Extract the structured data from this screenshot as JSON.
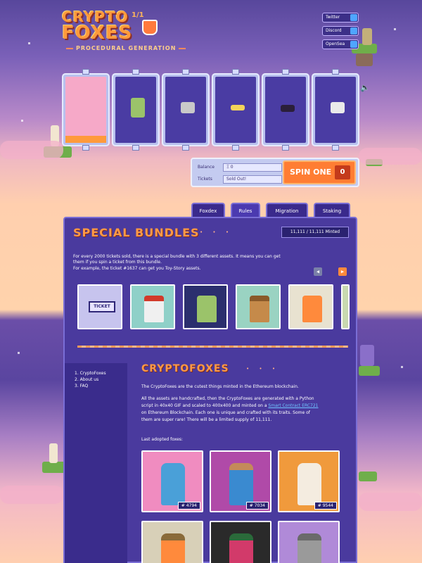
{
  "header": {
    "logo_line1": "CRYPTO",
    "logo_line2": "FOXES",
    "edition": "1/1",
    "tagline": "PROCEDURAL GENERATION"
  },
  "social": [
    {
      "label": "Twitter"
    },
    {
      "label": "Discord"
    },
    {
      "label": "OpenSea"
    }
  ],
  "machine": {
    "balance_label": "Balance",
    "balance_value": "Ξ 0",
    "tickets_label": "Tickets",
    "tickets_value": "Sold Out!",
    "spin_label": "SPIN ONE",
    "spin_count": "0",
    "reels": [
      {
        "asset": "background",
        "color": "#f6a9c8"
      },
      {
        "asset": "fox-body",
        "color": "#9bc36a"
      },
      {
        "asset": "hat",
        "color": "#c9c9c9"
      },
      {
        "asset": "eyes",
        "color": "#f3d35a"
      },
      {
        "asset": "mouth",
        "color": "#2b1f3a"
      },
      {
        "asset": "accessory",
        "color": "#eaeaea"
      }
    ]
  },
  "tabs": [
    {
      "label": "Foxdex"
    },
    {
      "label": "Rules"
    },
    {
      "label": "Migration"
    },
    {
      "label": "Staking"
    }
  ],
  "bundles": {
    "title": "SPECIAL BUNDLES",
    "dots": "• • •",
    "minted": "11,111 / 11,111 Minted",
    "desc_line1": "For every 2000 tickets sold, there is a special bundle with 3 different assets. It means you can get",
    "desc_line2": "them if you spin a ticket from this bundle.",
    "desc_line3": "For example, the ticket #1637 can get you Toy-Story assets.",
    "ticket_label": "TICKET",
    "prev_icon": "◀",
    "next_icon": "▶"
  },
  "sidebar": {
    "items": [
      {
        "label": "1. CryptoFoxes"
      },
      {
        "label": "2. About us"
      },
      {
        "label": "3. FAQ"
      }
    ]
  },
  "about": {
    "title": "CRYPTOFOXES",
    "dots": "• • •",
    "intro": "The CryptoFoxes are the cutest things minted in the Ethereum blockchain.",
    "p2_line1": "All the assets are handcrafted, then the CryptoFoxes are generated with a Python",
    "p2_line2a": "script in 40x40 GIF and scaled to 400x400 and minted on a ",
    "p2_link": "Smart Contract ERC721",
    "p2_line3": "on Ethereum Blockchain. Each one is unique and crafted with its traits. Some of",
    "p2_line4": "them are super rare! There will be a limited supply of 11,111.",
    "adopted_label": "Last adopted foxes:",
    "foxes": [
      {
        "id": "# 4794"
      },
      {
        "id": "# 7034"
      },
      {
        "id": "# 9544"
      }
    ]
  },
  "colors": {
    "accent": "#ff9a3c",
    "panel": "#4a3a9e",
    "link": "#6fc2ff"
  }
}
